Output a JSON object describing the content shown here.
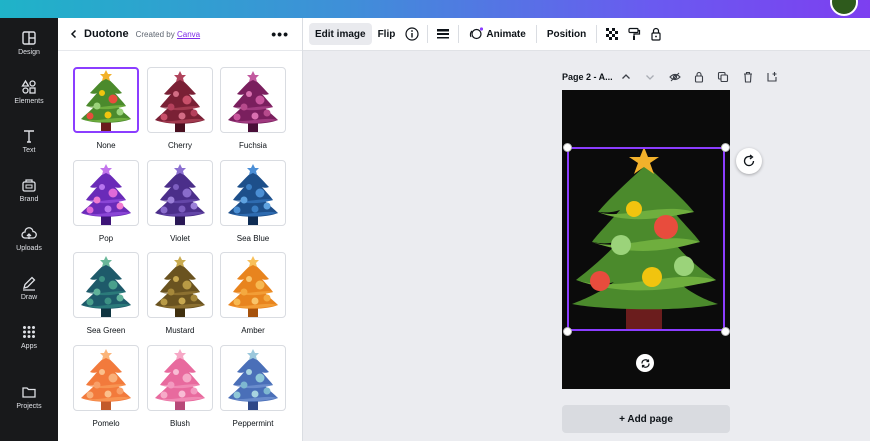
{
  "sidebar": {
    "items": [
      {
        "label": "Design",
        "icon": "layout-icon"
      },
      {
        "label": "Elements",
        "icon": "shapes-icon"
      },
      {
        "label": "Text",
        "icon": "text-icon"
      },
      {
        "label": "Brand",
        "icon": "brand-icon"
      },
      {
        "label": "Uploads",
        "icon": "cloud-upload-icon"
      },
      {
        "label": "Draw",
        "icon": "pen-icon"
      },
      {
        "label": "Apps",
        "icon": "grid-icon"
      },
      {
        "label": "Projects",
        "icon": "folder-icon"
      }
    ]
  },
  "panel": {
    "title": "Duotone",
    "created_by": "Created by",
    "creator": "Canva",
    "more": "•••",
    "filters": [
      {
        "label": "None",
        "c1": "#4b8a2c",
        "c2": "#6fae3e",
        "dots": [
          "#e84c3d",
          "#f1c40f",
          "#9bd37a"
        ],
        "trunk": "#6b1d1d",
        "star": "#f2b12b"
      },
      {
        "label": "Cherry",
        "c1": "#7a2035",
        "c2": "#a23a4f",
        "dots": [
          "#c9506a",
          "#d36c84",
          "#b5405c"
        ],
        "trunk": "#4a1020",
        "star": "#b0435c"
      },
      {
        "label": "Fuchsia",
        "c1": "#7a1f5e",
        "c2": "#a03a7f",
        "dots": [
          "#c8559d",
          "#d970b0",
          "#b64a8c"
        ],
        "trunk": "#4a0f38",
        "star": "#c25a9f"
      },
      {
        "label": "Pop",
        "c1": "#6a2bb8",
        "c2": "#8a45d6",
        "dots": [
          "#e06ad8",
          "#b775f0",
          "#f07ad0"
        ],
        "trunk": "#3d1478",
        "star": "#c274ec"
      },
      {
        "label": "Violet",
        "c1": "#4b2e8a",
        "c2": "#6446a8",
        "dots": [
          "#8a6ccc",
          "#7d5ec0",
          "#9b7fd8"
        ],
        "trunk": "#2a1856",
        "star": "#8b6fd0"
      },
      {
        "label": "Sea Blue",
        "c1": "#1d4f8a",
        "c2": "#2e6bb0",
        "dots": [
          "#4b8fd4",
          "#3a7ec4",
          "#5ea2e0"
        ],
        "trunk": "#0e2c54",
        "star": "#4a8ed6"
      },
      {
        "label": "Sea Green",
        "c1": "#1e5a6a",
        "c2": "#2b7a7a",
        "dots": [
          "#4aa08c",
          "#3c9184",
          "#5fb29a"
        ],
        "trunk": "#0f3440",
        "star": "#6ab89a"
      },
      {
        "label": "Mustard",
        "c1": "#6a5320",
        "c2": "#8c7030",
        "dots": [
          "#b89a45",
          "#c7a84f",
          "#a6883a"
        ],
        "trunk": "#40300e",
        "star": "#c9ab50"
      },
      {
        "label": "Amber",
        "c1": "#e8841e",
        "c2": "#f29d36",
        "dots": [
          "#f7b850",
          "#f9c46a",
          "#f4a940"
        ],
        "trunk": "#a6520c",
        "star": "#f8c05a"
      },
      {
        "label": "Pomelo",
        "c1": "#f27a3c",
        "c2": "#f79452",
        "dots": [
          "#f9b07a",
          "#fbc08c",
          "#f89f68"
        ],
        "trunk": "#c25a2a",
        "star": "#fbb57a"
      },
      {
        "label": "Blush",
        "c1": "#e86a9e",
        "c2": "#f08ab4",
        "dots": [
          "#f6aac8",
          "#f8bcd4",
          "#f39ac0"
        ],
        "trunk": "#b84878",
        "star": "#f6a8c6"
      },
      {
        "label": "Peppermint",
        "c1": "#4a6fb8",
        "c2": "#6a8ccc",
        "dots": [
          "#8fc8d8",
          "#a8d4e0",
          "#7eb8d0"
        ],
        "trunk": "#2e4888",
        "star": "#9cc8dc"
      }
    ]
  },
  "toolbar": {
    "edit_image": "Edit image",
    "flip": "Flip",
    "animate": "Animate",
    "position": "Position"
  },
  "page": {
    "label": "Page 2 - A...",
    "add_page": "+ Add page"
  },
  "colors": {
    "accent": "#8b3dff",
    "rail_bg": "#18191b",
    "canvas_bg": "#0b0b0b"
  }
}
